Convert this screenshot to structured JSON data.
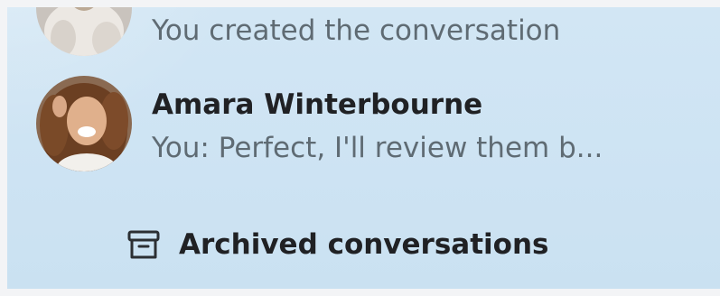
{
  "conversations": [
    {
      "title": "",
      "preview": "You created the conversation",
      "avatar_icon": "group-avatar-icon"
    },
    {
      "title": "Amara Winterbourne",
      "preview": "You: Perfect, I'll review them b...",
      "avatar_icon": "user-avatar-photo"
    }
  ],
  "archived": {
    "label": "Archived conversations",
    "icon": "archive-box-icon"
  },
  "colors": {
    "panel_bg": "#cfe4f3",
    "title_text": "#202124",
    "preview_text": "#5f6b73"
  }
}
